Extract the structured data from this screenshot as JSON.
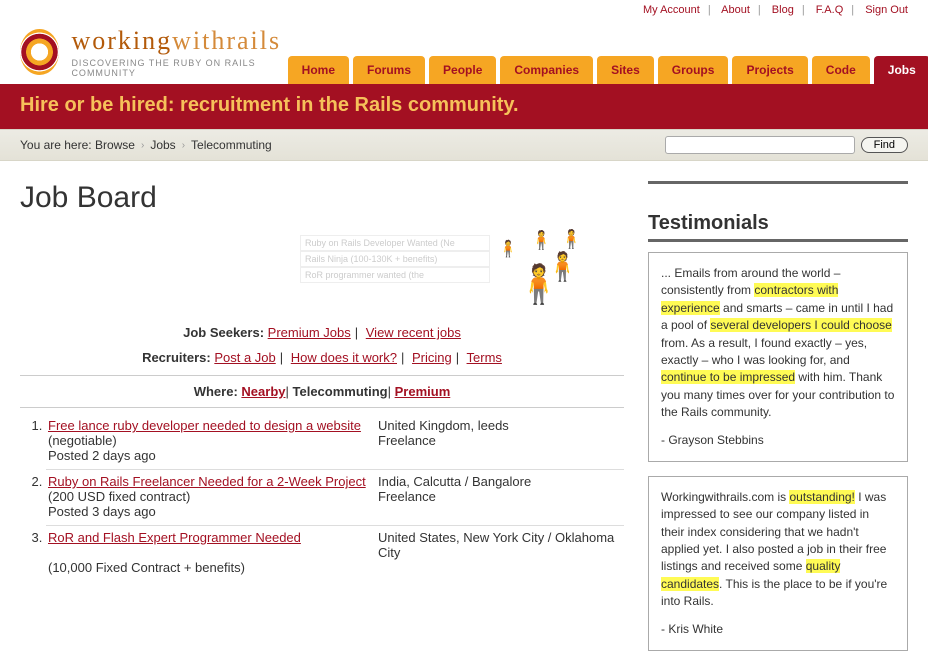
{
  "topnav": {
    "my_account": "My Account",
    "about": "About",
    "blog": "Blog",
    "faq": "F.A.Q",
    "signout": "Sign Out"
  },
  "brand": {
    "part1": "working",
    "part2": "withrails",
    "tagline": "DISCOVERING THE RUBY ON RAILS COMMUNITY"
  },
  "nav": {
    "home": "Home",
    "forums": "Forums",
    "people": "People",
    "companies": "Companies",
    "sites": "Sites",
    "groups": "Groups",
    "projects": "Projects",
    "code": "Code",
    "jobs": "Jobs"
  },
  "banner": "Hire or be hired: recruitment in the Rails community.",
  "crumbs": {
    "intro": "You are here:",
    "c1": "Browse",
    "c2": "Jobs",
    "c3": "Telecommuting"
  },
  "search": {
    "button": "Find"
  },
  "page_title": "Job Board",
  "promo": {
    "r1": "Ruby on Rails Developer Wanted (Ne",
    "r2": "Rails Ninja (100-130K + benefits)",
    "r3": "RoR programmer wanted (the"
  },
  "seekers": {
    "label": "Job Seekers:",
    "premium": "Premium Jobs",
    "recent": "View recent jobs"
  },
  "recruiters": {
    "label": "Recruiters:",
    "post": "Post a Job",
    "how": "How does it work?",
    "pricing": "Pricing",
    "terms": "Terms"
  },
  "filter": {
    "label": "Where:",
    "nearby": "Nearby",
    "tele": "Telecommuting",
    "premium": "Premium"
  },
  "jobs": [
    {
      "title": "Free lance ruby developer needed to design a website",
      "pay": "(negotiable)",
      "posted": "Posted 2 days ago",
      "loc": "United Kingdom, leeds",
      "type": "Freelance"
    },
    {
      "title": "Ruby on Rails Freelancer Needed for a 2-Week Project",
      "pay": "(200 USD fixed contract)",
      "posted": "Posted 3 days ago",
      "loc": "India, Calcutta / Bangalore",
      "type": "Freelance"
    },
    {
      "title": "RoR and Flash Expert Programmer Needed",
      "pay": "(10,000 Fixed Contract + benefits)",
      "posted": "",
      "loc": "United States, New York City / Oklahoma City",
      "type": ""
    }
  ],
  "testimonials_heading": "Testimonials",
  "t1": {
    "p1a": "... Emails from around the world – consistently from ",
    "h1": "contractors with experience",
    "p1b": " and smarts – came in until I had a pool of ",
    "h2": "several developers I could choose",
    "p1c": " from. As a result, I found exactly – yes, exactly – who I was looking for, and ",
    "h3": "continue to be impressed",
    "p1d": " with him. Thank you many times over for your contribution to the Rails community.",
    "author": "- Grayson Stebbins"
  },
  "t2": {
    "p1a": "Workingwithrails.com is ",
    "h1": "outstanding!",
    "p1b": " I was impressed to see our company listed in their index considering that we hadn't applied yet. I also posted a job in their free listings and received some ",
    "h2": "quality candidates",
    "p1c": ". This is the place to be if you're into Rails.",
    "author": "- Kris White"
  }
}
